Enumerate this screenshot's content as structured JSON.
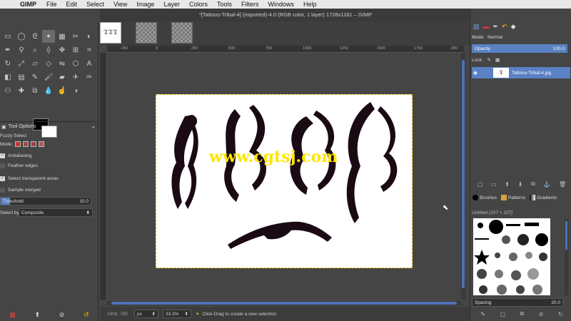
{
  "menubar": {
    "app": "GIMP",
    "items": [
      "File",
      "Edit",
      "Select",
      "View",
      "Image",
      "Layer",
      "Colors",
      "Tools",
      "Filters",
      "Windows",
      "Help"
    ]
  },
  "window": {
    "title": "*[Tattoos-Tribal-4] (imported)-4.0 (RGB color, 1 layer) 1728x1181 – GIMP"
  },
  "toolbox": {
    "tool_options_title": "Tool Options",
    "tool_name": "Fuzzy Select",
    "mode_label": "Mode:",
    "antialiasing": "Antialiasing",
    "feather_edges": "Feather edges",
    "select_transparent": "Select transparent areas",
    "sample_merged": "Sample merged",
    "threshold_label": "Threshold",
    "threshold_value": "15.0",
    "select_by_label": "Select by:",
    "select_by_value": "Composite"
  },
  "canvas": {
    "ruler_labels": [
      "-250",
      "0",
      "250",
      "500",
      "750",
      "1000",
      "1250",
      "1500",
      "1750",
      "200"
    ],
    "watermark": "www.cgtsj.com"
  },
  "status": {
    "coords": "1806, 780",
    "unit": "px",
    "zoom": "33.3%",
    "message": "Click-Drag to create a new selection"
  },
  "layers": {
    "mode_label": "Mode:",
    "mode_value": "Normal",
    "opacity_label": "Opacity",
    "opacity_value": "100.0",
    "lock_label": "Lock:",
    "layer_name": "Tattoos-Tribal-4.jpg"
  },
  "brushes": {
    "tabs": [
      "Brushes",
      "Patterns",
      "Gradients"
    ],
    "brush_name": "Untitled (107 × 107)",
    "spacing_label": "Spacing",
    "spacing_value": "20.0"
  }
}
